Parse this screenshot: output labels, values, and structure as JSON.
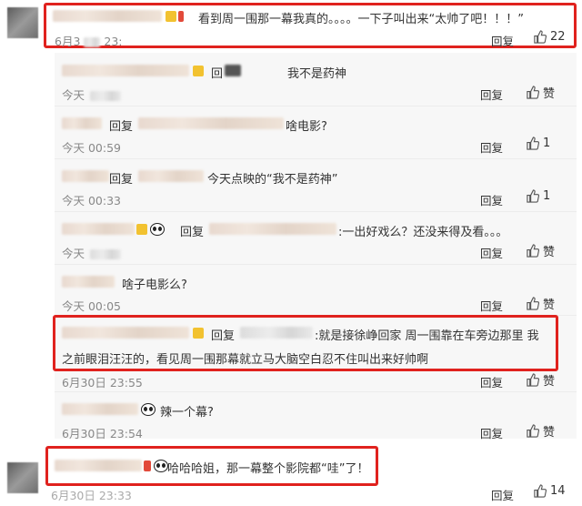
{
  "top_comment": {
    "text": "看到周一围那一幕我真的。。。。一下子叫出来“太帅了吧！！！”",
    "time": "6月3",
    "time2": "23:",
    "reply": "回复",
    "likes": "22"
  },
  "replies": [
    {
      "prefix": "回",
      "text": "我不是药神",
      "time": "今天",
      "reply": "回复",
      "likes": "赞"
    },
    {
      "prefix": "回复",
      "text": "啥电影?",
      "time": "今天 00:59",
      "reply": "回复",
      "likes": "1"
    },
    {
      "prefix": "回复",
      "text": "今天点映的“我不是药神”",
      "time": "今天 00:33",
      "reply": "回复",
      "likes": "1"
    },
    {
      "prefix": "回复",
      "text": ":一出好戏么？还没来得及看。。。",
      "time": "今天",
      "reply": "回复",
      "likes": "赞"
    },
    {
      "prefix": "",
      "text": "啥子电影么?",
      "time": "今天 00:05",
      "reply": "回复",
      "likes": "赞"
    },
    {
      "prefix": "回复",
      "text": ":就是接徐峥回家 周一围靠在车旁边那里 我",
      "text2": "之前眼泪汪汪的，看见周一围那幕就立马大脑空白忍不住叫出来好帅啊",
      "time": "6月30日 23:55",
      "reply": "回复",
      "likes": "赞"
    },
    {
      "prefix": "",
      "text": "辣一个幕?",
      "time": "6月30日 23:54",
      "reply": "回复",
      "likes": "赞"
    }
  ],
  "bottom_comment": {
    "text": "哈哈哈姐，那一幕整个影院都“哇”了！",
    "time": "6月30日 23:33",
    "reply": "回复",
    "likes": "14"
  },
  "colors": {
    "highlight": "#e0221e",
    "muted": "#888888"
  }
}
